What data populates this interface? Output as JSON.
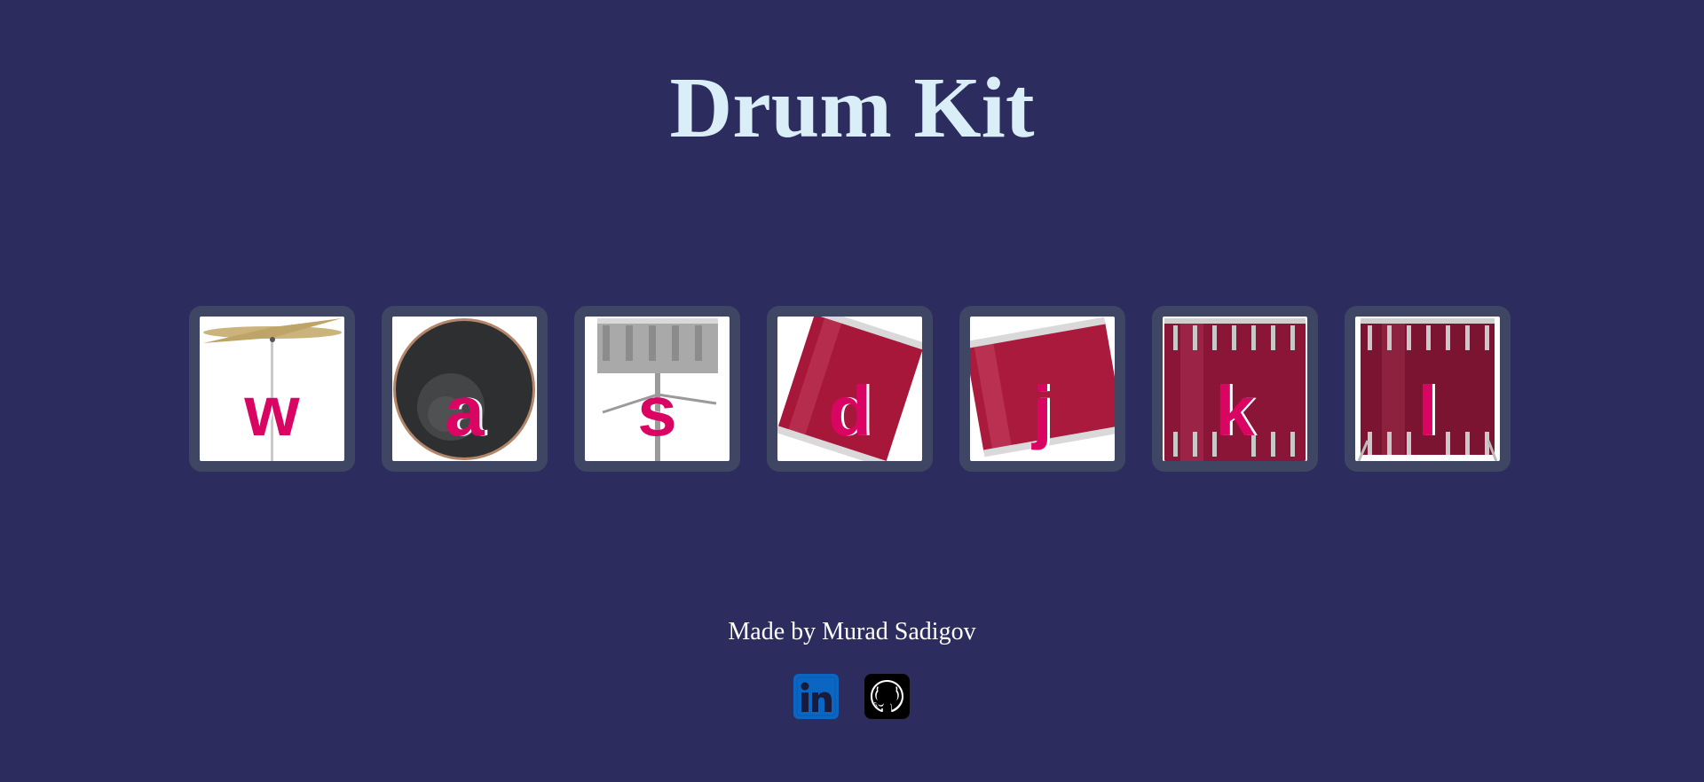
{
  "page": {
    "title": "Drum Kit",
    "background": "#2c2c5e",
    "title_color": "#daeef7",
    "accent": "#da0463"
  },
  "drums": [
    {
      "key": "w",
      "instrument": "crash cymbal",
      "icon": "crash-icon"
    },
    {
      "key": "a",
      "instrument": "kick bass",
      "icon": "kick-icon"
    },
    {
      "key": "s",
      "instrument": "snare",
      "icon": "snare-icon"
    },
    {
      "key": "d",
      "instrument": "tom 1",
      "icon": "tom-icon"
    },
    {
      "key": "j",
      "instrument": "tom 2",
      "icon": "tom-icon"
    },
    {
      "key": "k",
      "instrument": "tom 3",
      "icon": "tom-icon"
    },
    {
      "key": "l",
      "instrument": "tom 4",
      "icon": "tom-icon"
    }
  ],
  "footer": {
    "text": "Made by Murad Sadigov",
    "links": [
      {
        "name": "linkedin",
        "icon": "linkedin-icon",
        "color": "#0a66c2"
      },
      {
        "name": "github",
        "icon": "github-icon",
        "color": "#000000"
      }
    ]
  }
}
